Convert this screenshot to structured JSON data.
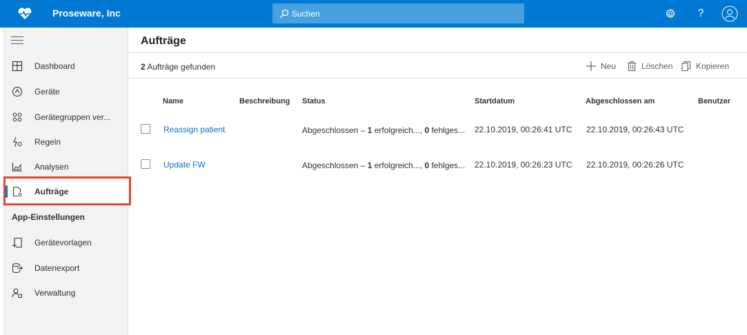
{
  "app": {
    "name": "Proseware, Inc",
    "logo_icon": "heart-pulse-icon"
  },
  "search": {
    "placeholder": "Suchen",
    "icon": "search-icon"
  },
  "topbar_icons": [
    "settings-icon",
    "help-icon",
    "user-avatar-icon"
  ],
  "topbar": {
    "help_glyph": "?"
  },
  "sidebar": {
    "items": [
      {
        "label": "Dashboard",
        "icon": "dashboard-icon"
      },
      {
        "label": "Geräte",
        "icon": "devices-icon"
      },
      {
        "label": "Gerätegruppen ver...",
        "icon": "device-groups-icon"
      },
      {
        "label": "Regeln",
        "icon": "rules-icon"
      },
      {
        "label": "Analysen",
        "icon": "analytics-icon"
      },
      {
        "label": "Aufträge",
        "icon": "jobs-icon",
        "active": true
      }
    ],
    "section_title": "App-Einstellungen",
    "settings_items": [
      {
        "label": "Gerätevorlagen",
        "icon": "device-templates-icon"
      },
      {
        "label": "Datenexport",
        "icon": "data-export-icon"
      },
      {
        "label": "Verwaltung",
        "icon": "administration-icon"
      }
    ]
  },
  "main": {
    "title": "Aufträge",
    "count_number": "2",
    "count_text": " Aufträge gefunden",
    "commands": {
      "new": "Neu",
      "delete": "Löschen",
      "copy": "Kopieren"
    },
    "columns": [
      "Name",
      "Beschreibung",
      "Status",
      "Startdatum",
      "Abgeschlossen am",
      "Benutzer"
    ],
    "rows": [
      {
        "name": "Reassign patient",
        "description": "",
        "status_prefix": "Abgeschlossen – ",
        "status_success_count": "1",
        "status_success_text": " erfolgreich..., ",
        "status_failed_count": "0",
        "status_failed_text": " fehlges...",
        "start": "22.10.2019, 00:26:41 UTC",
        "completed": "22.10.2019, 00:26:43 UTC",
        "user": ""
      },
      {
        "name": "Update FW",
        "description": "",
        "status_prefix": "Abgeschlossen – ",
        "status_success_count": "1",
        "status_success_text": " erfolgreich..., ",
        "status_failed_count": "0",
        "status_failed_text": " fehlges...",
        "start": "22.10.2019, 00:26:23 UTC",
        "completed": "22.10.2019, 00:26:26 UTC",
        "user": ""
      }
    ]
  },
  "colors": {
    "brand": "#0078d4",
    "link": "#106ebe",
    "highlight": "#e8432b"
  }
}
